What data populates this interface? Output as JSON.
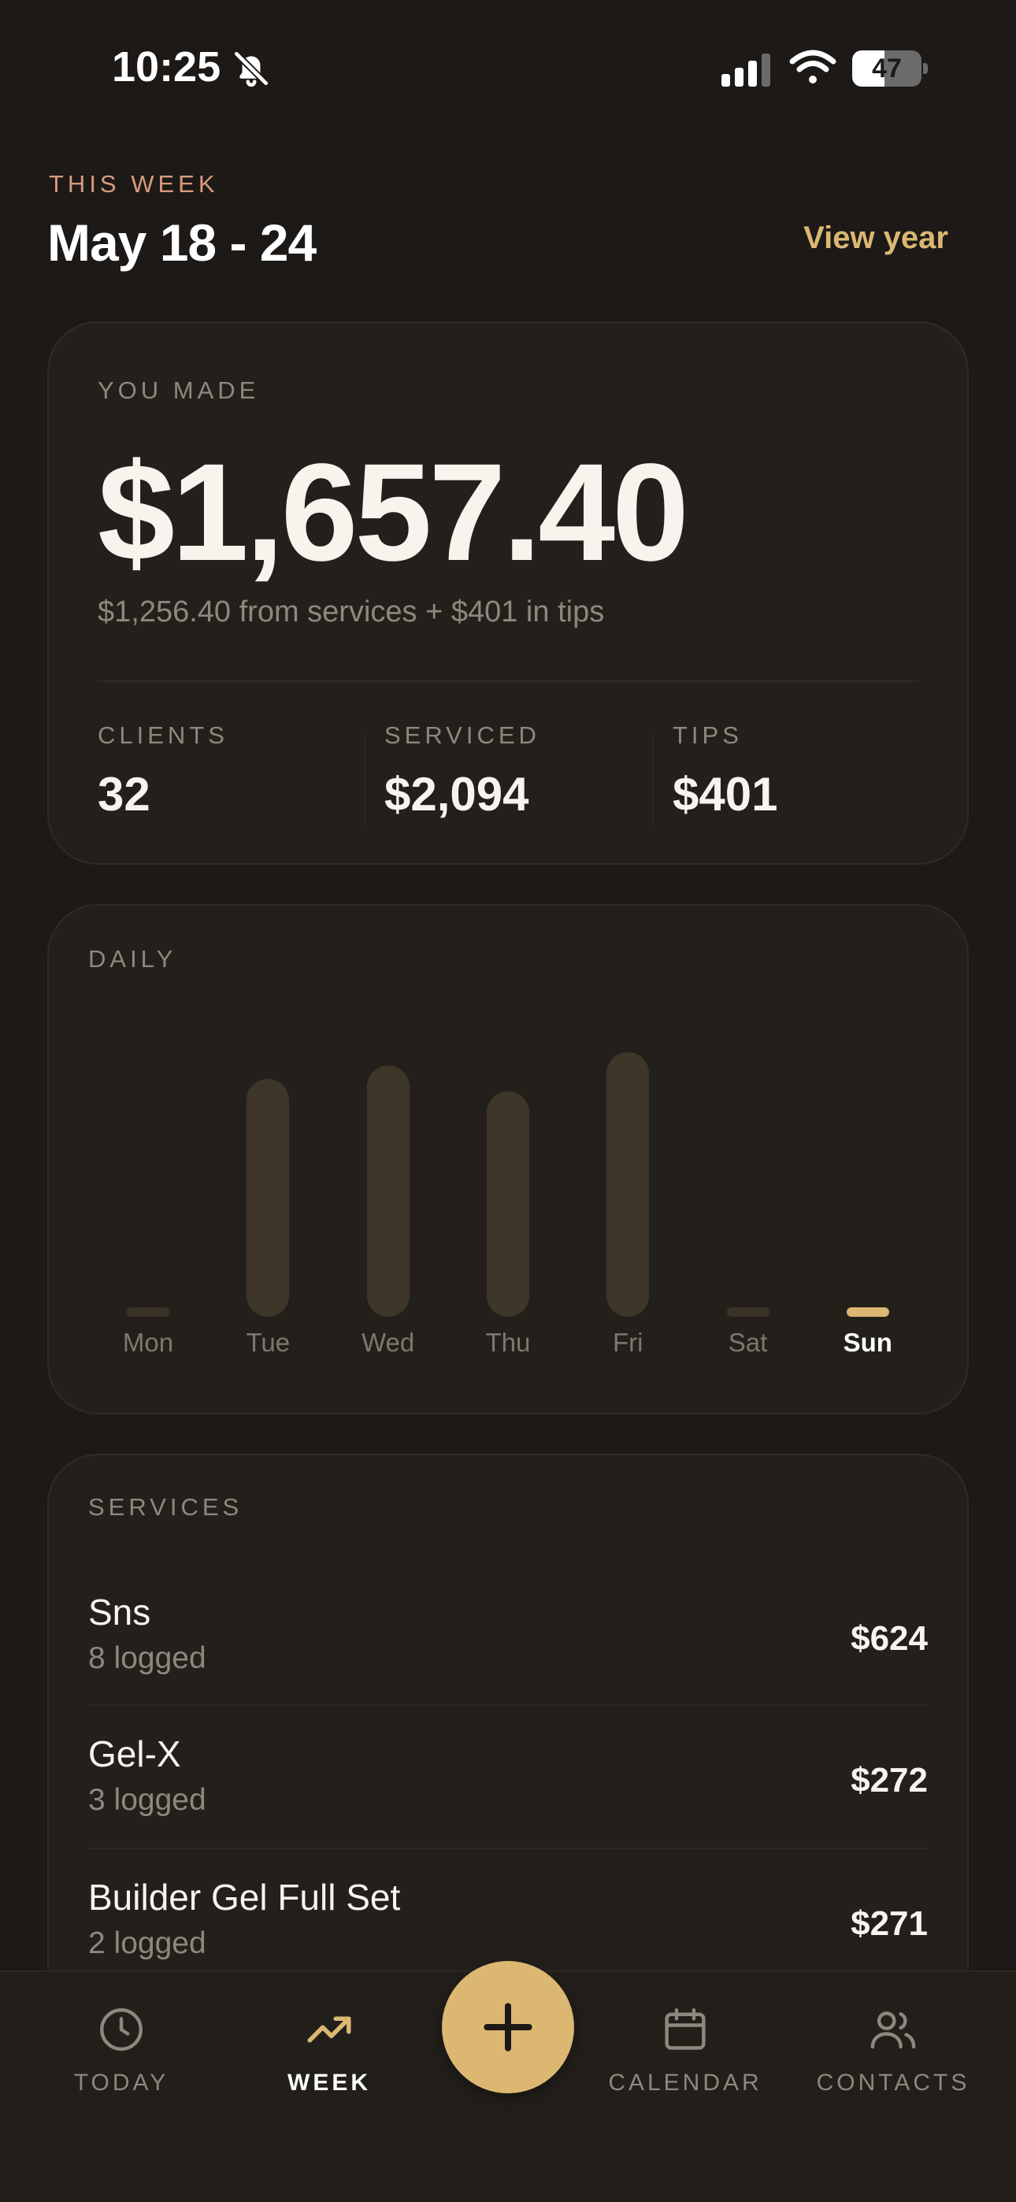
{
  "status_bar": {
    "time": "10:25",
    "battery_percent": "47",
    "battery_level": 0.47,
    "icons": [
      "bell-slash-icon",
      "cellular-signal-icon",
      "wifi-icon",
      "battery-icon"
    ]
  },
  "header": {
    "eyebrow": "THIS WEEK",
    "title": "May 18 - 24",
    "view_year": "View year"
  },
  "summary": {
    "label": "YOU MADE",
    "amount": "$1,657.40",
    "breakdown": "$1,256.40 from services + $401 in tips",
    "stats": [
      {
        "label": "CLIENTS",
        "value": "32"
      },
      {
        "label": "SERVICED",
        "value": "$2,094"
      },
      {
        "label": "TIPS",
        "value": "$401"
      }
    ]
  },
  "daily": {
    "label": "DAILY"
  },
  "chart_data": {
    "type": "bar",
    "categories": [
      "Mon",
      "Tue",
      "Wed",
      "Thu",
      "Fri",
      "Sat",
      "Sun"
    ],
    "values": [
      0,
      0.9,
      0.95,
      0.85,
      1.0,
      0,
      0
    ],
    "active_category": "Sun",
    "title": "DAILY",
    "xlabel": "",
    "ylabel": "",
    "ylim": [
      0,
      1
    ],
    "grid": false,
    "colors": {
      "bar": "#3e3629",
      "active": "#dcb772"
    }
  },
  "services": {
    "label": "SERVICES",
    "items": [
      {
        "name": "Sns",
        "count": "8 logged",
        "amount": "$624"
      },
      {
        "name": "Gel-X",
        "count": "3 logged",
        "amount": "$272"
      },
      {
        "name": "Builder Gel Full Set",
        "count": "2 logged",
        "amount": "$271"
      }
    ]
  },
  "tab_bar": {
    "tabs": [
      {
        "label": "TODAY",
        "icon": "clock-icon",
        "active": false
      },
      {
        "label": "WEEK",
        "icon": "trending-up-icon",
        "active": true
      },
      {
        "label": "CALENDAR",
        "icon": "calendar-icon",
        "active": false
      },
      {
        "label": "CONTACTS",
        "icon": "users-icon",
        "active": false
      }
    ],
    "fab_icon": "plus-icon"
  },
  "colors": {
    "background": "#1c1917",
    "card": "#23201c",
    "accent": "#dcb772",
    "eyebrow": "#d99a7d",
    "muted": "#8f877d"
  }
}
